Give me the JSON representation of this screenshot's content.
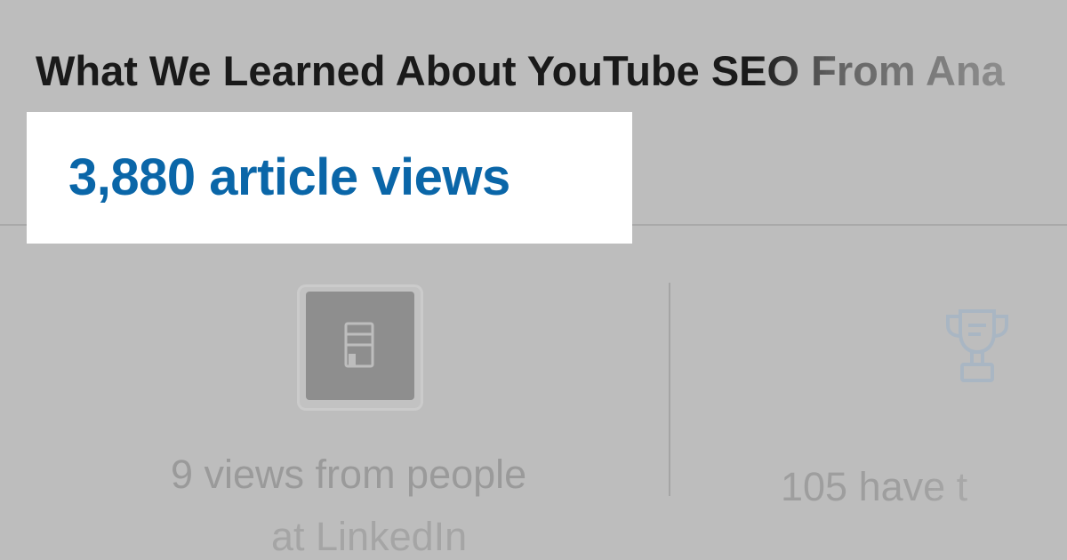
{
  "article": {
    "title": "What We Learned About YouTube SEO From Ana"
  },
  "highlight": {
    "views_label": "3,880 article views"
  },
  "stats": {
    "left": {
      "icon": "company-building-icon",
      "line1": "9 views from people",
      "line2": "at LinkedIn"
    },
    "right": {
      "icon": "trophy-icon",
      "line1": "105 have t"
    }
  },
  "colors": {
    "background": "#bdbdbd",
    "highlight_bg": "#ffffff",
    "accent_blue": "#0a66a8",
    "title_text": "#1a1a1a"
  }
}
